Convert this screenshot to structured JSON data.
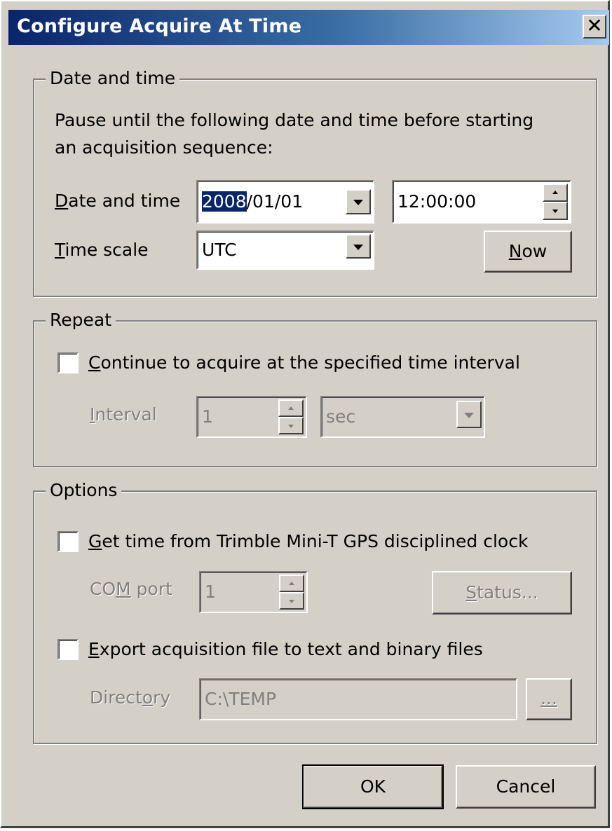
{
  "window": {
    "title": "Configure Acquire At Time",
    "close_glyph": "✕"
  },
  "date_time_group": {
    "legend": "Date and time",
    "description_line1": "Pause until the following date and time before starting",
    "description_line2": "an acquisition sequence:",
    "date_label": {
      "mnemonic": "D",
      "rest": "ate and time"
    },
    "date_value": {
      "selected": "2008",
      "rest": "/01/01"
    },
    "time_value": "12:00:00",
    "timescale_label": {
      "mnemonic": "T",
      "rest": "ime scale"
    },
    "timescale_value": "UTC",
    "now_button": {
      "mnemonic": "N",
      "rest": "ow"
    }
  },
  "repeat_group": {
    "legend": "Repeat",
    "continue_checkbox": {
      "mnemonic": "C",
      "rest": "ontinue to acquire at the specified time interval",
      "checked": false
    },
    "interval_label": {
      "mnemonic": "I",
      "rest": "nterval"
    },
    "interval_value": "1",
    "unit_value": "sec"
  },
  "options_group": {
    "legend": "Options",
    "gps_checkbox": {
      "mnemonic": "G",
      "rest": "et time from Trimble Mini-T GPS disciplined clock",
      "checked": false
    },
    "com_port_label": {
      "pre": "CO",
      "mnemonic": "M",
      "post": " port"
    },
    "com_port_value": "1",
    "status_button": {
      "mnemonic": "S",
      "rest": "tatus..."
    },
    "export_checkbox": {
      "mnemonic": "E",
      "rest": "xport acquisition file to text and binary files",
      "checked": false
    },
    "directory_label": {
      "pre": "Direct",
      "mnemonic": "o",
      "post": "ry"
    },
    "directory_value": "C:\\TEMP",
    "browse_button": "..."
  },
  "footer": {
    "ok_label": "OK",
    "cancel_label": "Cancel"
  }
}
